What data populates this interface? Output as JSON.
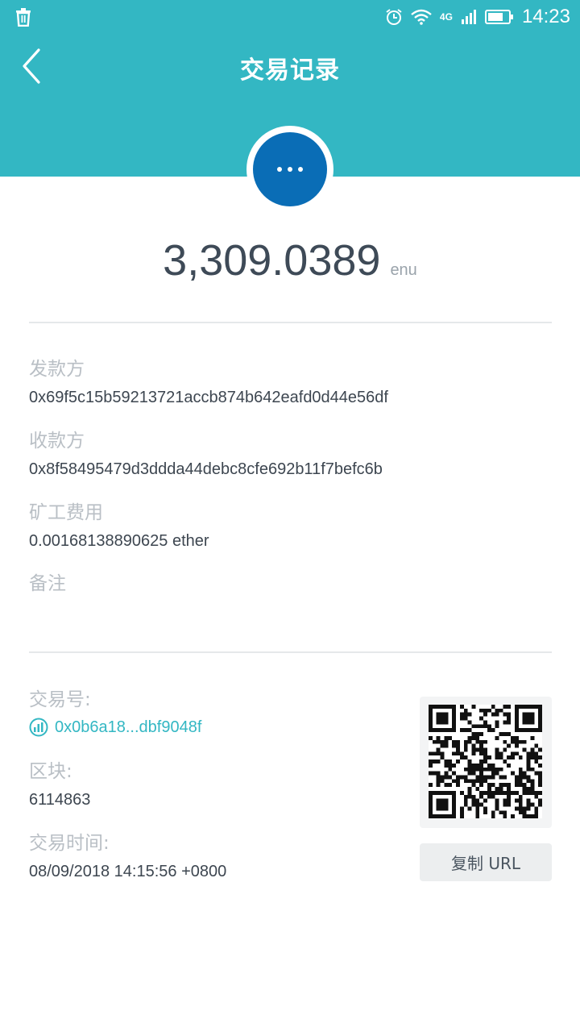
{
  "status_bar": {
    "network": "4G",
    "time": "14:23"
  },
  "header": {
    "title": "交易记录"
  },
  "amount": {
    "value": "3,309.0389",
    "unit": "enu"
  },
  "details": {
    "sender_label": "发款方",
    "sender_value": "0x69f5c15b59213721accb874b642eafd0d44e56df",
    "receiver_label": "收款方",
    "receiver_value": "0x8f58495479d3ddda44debc8cfe692b11f7befc6b",
    "fee_label": "矿工费用",
    "fee_value": "0.00168138890625 ether",
    "note_label": "备注",
    "note_value": ""
  },
  "tx": {
    "hash_label": "交易号:",
    "hash_value": "0x0b6a18...dbf9048f",
    "block_label": "区块:",
    "block_value": "6114863",
    "time_label": "交易时间:",
    "time_value": "08/09/2018 14:15:56 +0800",
    "copy_label": "复制 URL"
  },
  "colors": {
    "header_bg": "#33b7c3",
    "avatar_bg": "#0a6db6",
    "link": "#33b7c3"
  }
}
